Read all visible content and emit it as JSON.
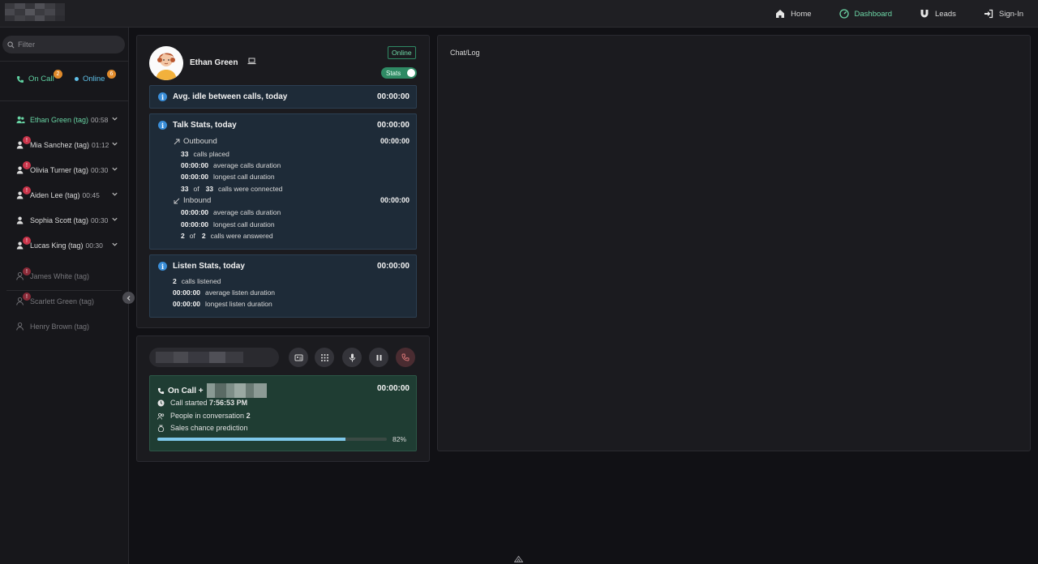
{
  "nav": {
    "items": [
      {
        "label": "Home",
        "icon": "home-icon",
        "active": false
      },
      {
        "label": "Dashboard",
        "icon": "dashboard-icon",
        "active": true
      },
      {
        "label": "Leads",
        "icon": "magnet-icon",
        "active": false
      },
      {
        "label": "Sign-In",
        "icon": "sign-in-icon",
        "active": false
      }
    ],
    "accent": "#6dd6a6"
  },
  "sidebar": {
    "filter_placeholder": "Filter",
    "on_call_label": "On Call",
    "on_call_count": "2",
    "online_label": "Online",
    "online_count": "6",
    "agents": [
      {
        "name": "Ethan Green (tag)",
        "time": "00:58",
        "badge": ""
      },
      {
        "name": "Mia Sanchez (tag)",
        "time": "01:12",
        "badge": "!"
      },
      {
        "name": "Olivia Turner (tag)",
        "time": "00:30",
        "badge": "!"
      },
      {
        "name": "Aiden Lee (tag)",
        "time": "00:45",
        "badge": "!"
      },
      {
        "name": "Sophia Scott (tag)",
        "time": "00:30",
        "badge": ""
      },
      {
        "name": "Lucas King (tag)",
        "time": "00:30",
        "badge": "!"
      }
    ],
    "offline_agents": [
      {
        "name": "James White (tag)",
        "badge": "!"
      },
      {
        "name": "Scarlett Green (tag)",
        "badge": "!"
      },
      {
        "name": "Henry Brown (tag)",
        "badge": ""
      }
    ]
  },
  "agent_panel": {
    "name": "Ethan Green",
    "status": "Online",
    "stats_toggle": "Stats",
    "idle": {
      "title": "Avg. idle between calls, today",
      "time": "00:00:00"
    },
    "talk": {
      "title": "Talk Stats, today",
      "time": "00:00:00",
      "outbound_label": "Outbound",
      "outbound_time": "00:00:00",
      "calls_placed": "33",
      "calls_placed_label": "calls placed",
      "avg_duration": "00:00:00",
      "avg_duration_label": "average calls duration",
      "longest": "00:00:00",
      "longest_label": "longest call duration",
      "connected": "33",
      "of_label": "of",
      "connected_total": "33",
      "connected_label": "calls were connected",
      "inbound_label": "Inbound",
      "inbound_time": "00:00:00",
      "in_avg": "00:00:00",
      "in_avg_label": "average calls duration",
      "in_longest": "00:00:00",
      "in_longest_label": "longest call duration",
      "answered": "2",
      "answered_total": "2",
      "answered_label": "calls were answered"
    },
    "listen": {
      "title": "Listen Stats, today",
      "time": "00:00:00",
      "listened": "2",
      "listened_label": "calls listened",
      "avg": "00:00:00",
      "avg_label": "average listen duration",
      "longest": "00:00:00",
      "longest_label": "longest listen duration"
    }
  },
  "call": {
    "title": "On Call +",
    "time": "00:00:00",
    "started_label": "Call started",
    "started_value": "7:56:53 PM",
    "people_label": "People in conversation",
    "people_value": "2",
    "prediction_label": "Sales chance prediction",
    "prediction_pct": 82,
    "prediction_text": "82%"
  },
  "chatlog": {
    "title": "Chat/Log"
  }
}
